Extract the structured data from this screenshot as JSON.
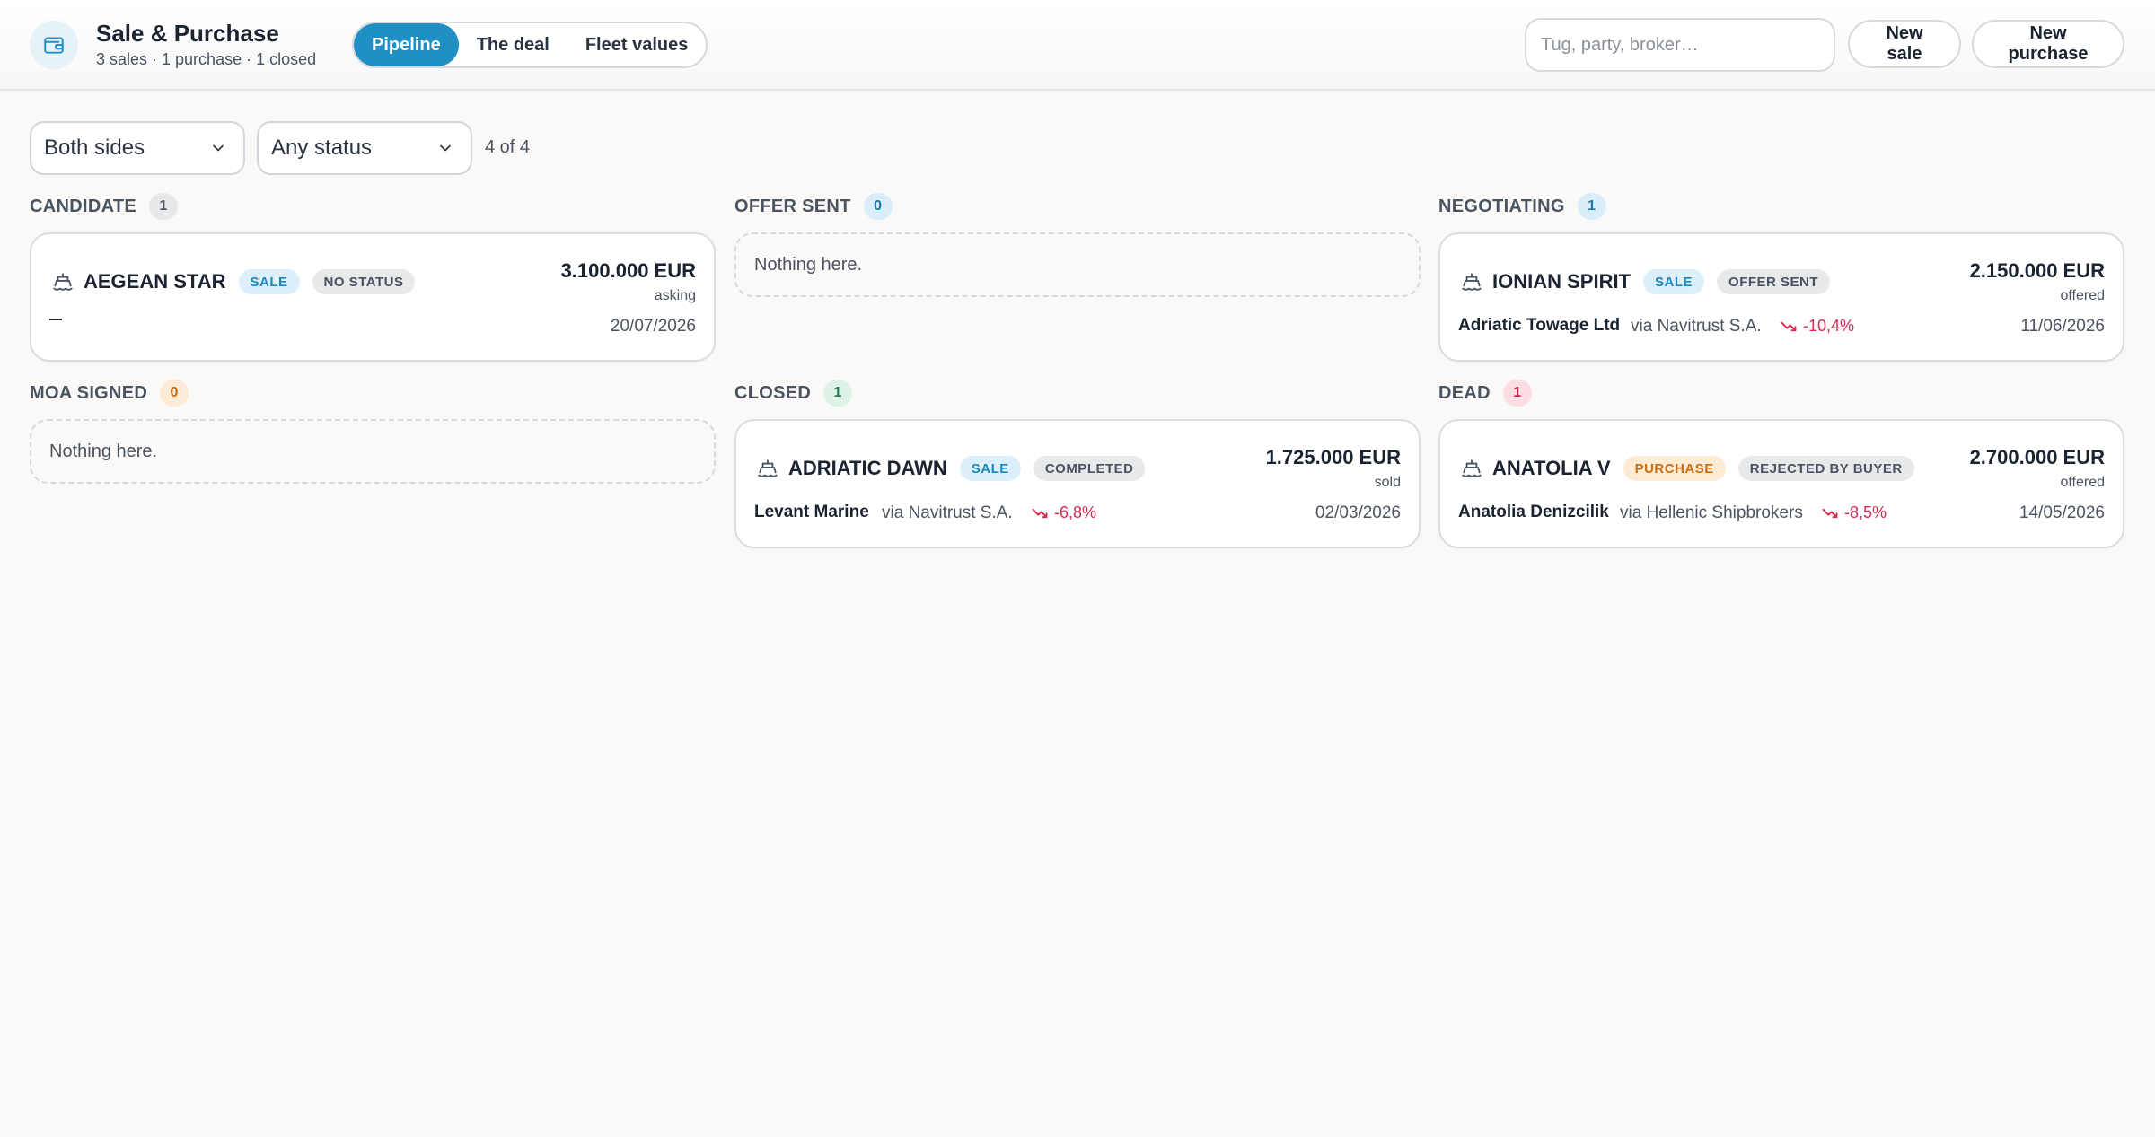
{
  "app": {
    "title": "Sale & Purchase",
    "subtitle": "3 sales · 1 purchase · 1 closed"
  },
  "tabs": [
    {
      "label": "Pipeline",
      "active": true
    },
    {
      "label": "The deal",
      "active": false
    },
    {
      "label": "Fleet values",
      "active": false
    }
  ],
  "search": {
    "placeholder": "Tug, party, broker…",
    "value": ""
  },
  "actions": {
    "new_sale": "New sale",
    "new_purchase": "New purchase"
  },
  "filters": {
    "side": "Both sides",
    "status": "Any status",
    "count": "4 of 4"
  },
  "columns": {
    "candidate": {
      "label": "CANDIDATE",
      "count": "1"
    },
    "offer_sent": {
      "label": "OFFER SENT",
      "count": "0",
      "empty": "Nothing here."
    },
    "negotiating": {
      "label": "NEGOTIATING",
      "count": "1"
    },
    "moa_signed": {
      "label": "MOA SIGNED",
      "count": "0",
      "empty": "Nothing here."
    },
    "closed": {
      "label": "CLOSED",
      "count": "1"
    },
    "dead": {
      "label": "DEAD",
      "count": "1"
    }
  },
  "cards": {
    "aegean": {
      "name": "AEGEAN STAR",
      "side": "SALE",
      "status": "NO STATUS",
      "amount": "3.100.000 EUR",
      "amount_note": "asking",
      "date": "20/07/2026"
    },
    "ionian": {
      "name": "IONIAN SPIRIT",
      "side": "SALE",
      "status": "OFFER SENT",
      "amount": "2.150.000 EUR",
      "amount_note": "offered",
      "party": "Adriatic Towage Ltd",
      "broker": "via Navitrust S.A.",
      "delta": "-10,4%",
      "date": "11/06/2026"
    },
    "adriatic": {
      "name": "ADRIATIC DAWN",
      "side": "SALE",
      "status": "COMPLETED",
      "amount": "1.725.000 EUR",
      "amount_note": "sold",
      "party": "Levant Marine",
      "broker": "via Navitrust S.A.",
      "delta": "-6,8%",
      "date": "02/03/2026"
    },
    "anatolia": {
      "name": "ANATOLIA V",
      "side": "PURCHASE",
      "status": "REJECTED BY BUYER",
      "amount": "2.700.000 EUR",
      "amount_note": "offered",
      "party": "Anatolia Denizcilik",
      "broker": "via Hellenic Shipbrokers",
      "delta": "-8,5%",
      "date": "14/05/2026"
    }
  },
  "colors": {
    "accent": "#1f8fc4",
    "negative": "#d8294f",
    "background": "#faf9f7"
  }
}
